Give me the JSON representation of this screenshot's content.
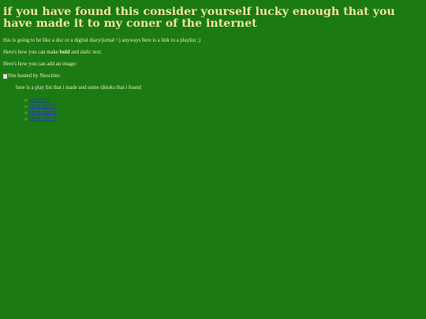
{
  "heading": "if you have found this consider yourself lucky enough that you have made it to my coner of the internet",
  "intro": "this is going to be like a doc or a digital diary/jurnal =) anyways here is a link to a playlist ;)",
  "formatting": {
    "prefix": "Here's how you can make ",
    "bold": "bold",
    "middle": " and ",
    "italic": "italic",
    "suffix": " text."
  },
  "image_hint": "Here's how you can add an image:",
  "image_alt": "Site hosted by Neocities",
  "playlist_intro": "here is a play list that i made and some tiktoks that i found",
  "links": [
    "playlist =)",
    "tiktok link #1",
    "tiktok link #2",
    "tiktok link #3"
  ],
  "colors": {
    "background": "#1b7a12",
    "text": "#f3efc4",
    "link": "#2a33c9"
  }
}
